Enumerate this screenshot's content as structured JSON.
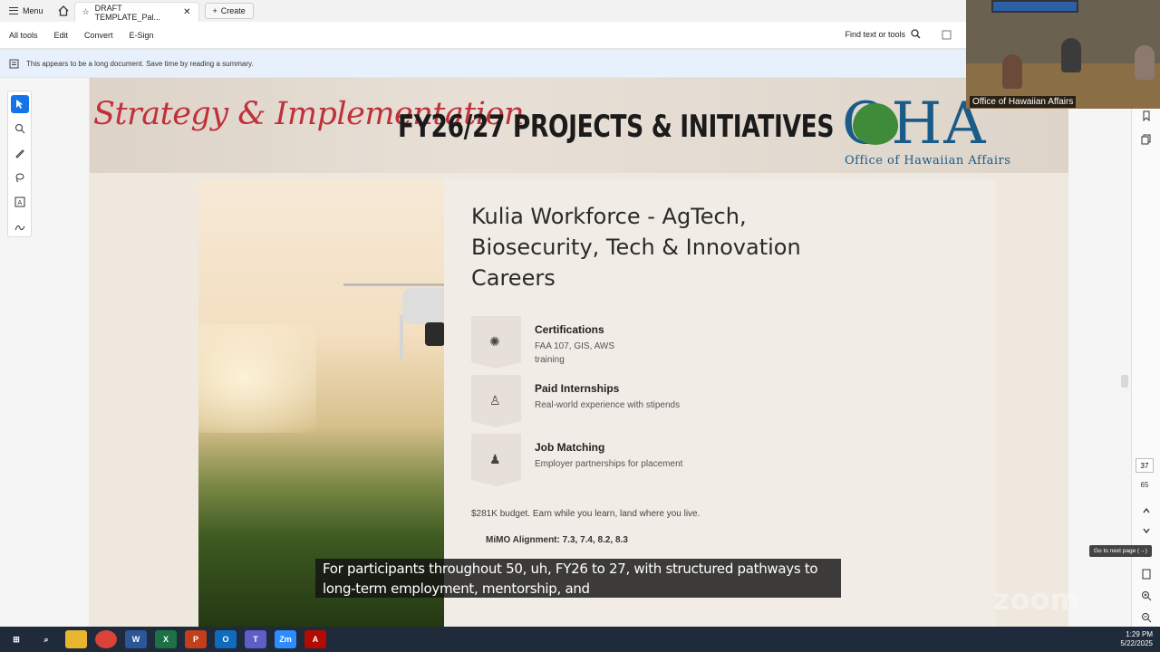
{
  "app": {
    "menu_label": "Menu",
    "tab_title": "DRAFT TEMPLATE_Pal...",
    "create_label": "Create"
  },
  "toolbar": {
    "all_tools": "All tools",
    "edit": "Edit",
    "convert": "Convert",
    "esign": "E-Sign",
    "find": "Find text or tools"
  },
  "infobar": {
    "message": "This appears to be a long document. Save time by reading a summary."
  },
  "slide": {
    "script_title": "Strategy & Implementation",
    "heading": "FY26/27 PROJECTS & INITIATIVES",
    "logo_text": "OHA",
    "logo_sub": "Office of Hawaiian Affairs",
    "title": "Kulia Workforce - AgTech, Biosecurity, Tech & Innovation Careers",
    "items": [
      {
        "heading": "Certifications",
        "desc": "FAA 107, GIS, AWS training",
        "icon": "badge-icon"
      },
      {
        "heading": "Paid Internships",
        "desc": "Real-world experience with stipends",
        "icon": "person-icon"
      },
      {
        "heading": "Job Matching",
        "desc": "Employer partnerships for placement",
        "icon": "worker-icon"
      }
    ],
    "budget": "$281K budget. Earn while you learn, land where you live.",
    "mimo": "MiMO Alignment: 7.3, 7.4, 8.2, 8.3"
  },
  "pager": {
    "current": "37",
    "total": "65",
    "tooltip": "Go to next page (→)"
  },
  "caption": "For participants throughout 50, uh, FY26 to 27, with structured pathways to long-term employment, mentorship, and",
  "video": {
    "label": "Office of Hawaiian Affairs"
  },
  "watermark": "zoom",
  "clock": {
    "time": "1:29 PM",
    "date": "5/22/2025"
  }
}
